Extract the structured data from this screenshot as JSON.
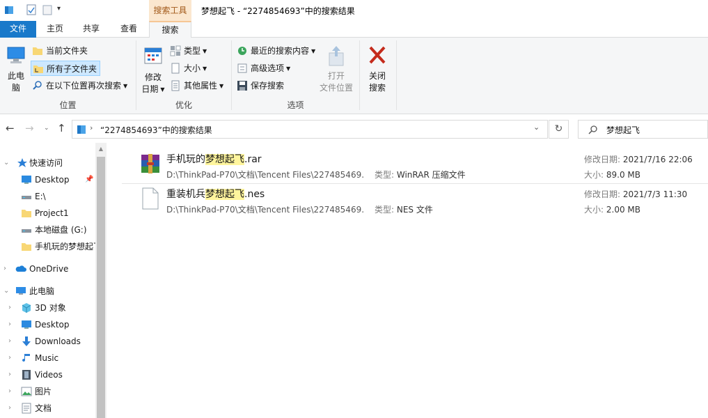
{
  "window": {
    "title": "梦想起飞 - “2274854693”中的搜索结果",
    "context_tab": "搜索工具"
  },
  "tabs": [
    "文件",
    "主页",
    "共享",
    "查看",
    "搜索"
  ],
  "ribbon": {
    "location": {
      "this_pc": [
        "此电",
        "脑"
      ],
      "current_folder": "当前文件夹",
      "all_subfolders": "所有子文件夹",
      "search_again": "在以下位置再次搜索",
      "group": "位置"
    },
    "refine": {
      "date_modified": [
        "修改",
        "日期"
      ],
      "kind": "类型",
      "size": "大小",
      "other_props": "其他属性",
      "group": "优化"
    },
    "options": {
      "recent": "最近的搜索内容",
      "advanced": "高级选项",
      "save": "保存搜索",
      "open_location": [
        "打开",
        "文件位置"
      ],
      "close": [
        "关闭",
        "搜索"
      ],
      "group": "选项"
    }
  },
  "address": {
    "path": "“2274854693”中的搜索结果",
    "search_value": "梦想起飞"
  },
  "nav": {
    "quick_access": "快速访问",
    "items_quick": [
      "Desktop",
      "E:\\",
      "Project1",
      "本地磁盘 (G:)",
      "手机玩的梦想起飞"
    ],
    "onedrive": "OneDrive",
    "this_pc": "此电脑",
    "items_pc": [
      "3D 对象",
      "Desktop",
      "Downloads",
      "Music",
      "Videos",
      "图片",
      "文档"
    ]
  },
  "results": [
    {
      "name_pre": "手机玩的",
      "name_hl": "梦想起飞",
      "name_post": ".rar",
      "path": "D:\\ThinkPad-P70\\文档\\Tencent Files\\227485469...",
      "type_label": "类型:",
      "type": "WinRAR 压缩文件",
      "date_label": "修改日期:",
      "date": "2021/7/16 22:06",
      "size_label": "大小:",
      "size": "89.0 MB"
    },
    {
      "name_pre": "重装机兵",
      "name_hl": "梦想起飞",
      "name_post": ".nes",
      "path": "D:\\ThinkPad-P70\\文档\\Tencent Files\\227485469...",
      "type_label": "类型:",
      "type": "NES 文件",
      "date_label": "修改日期:",
      "date": "2021/7/3 11:30",
      "size_label": "大小:",
      "size": "2.00 MB"
    }
  ],
  "colors": {
    "accent": "#1979ca",
    "context_tab_bg": "#fbe7cf",
    "highlight": "#fff59d",
    "close_red": "#c42b1c"
  }
}
